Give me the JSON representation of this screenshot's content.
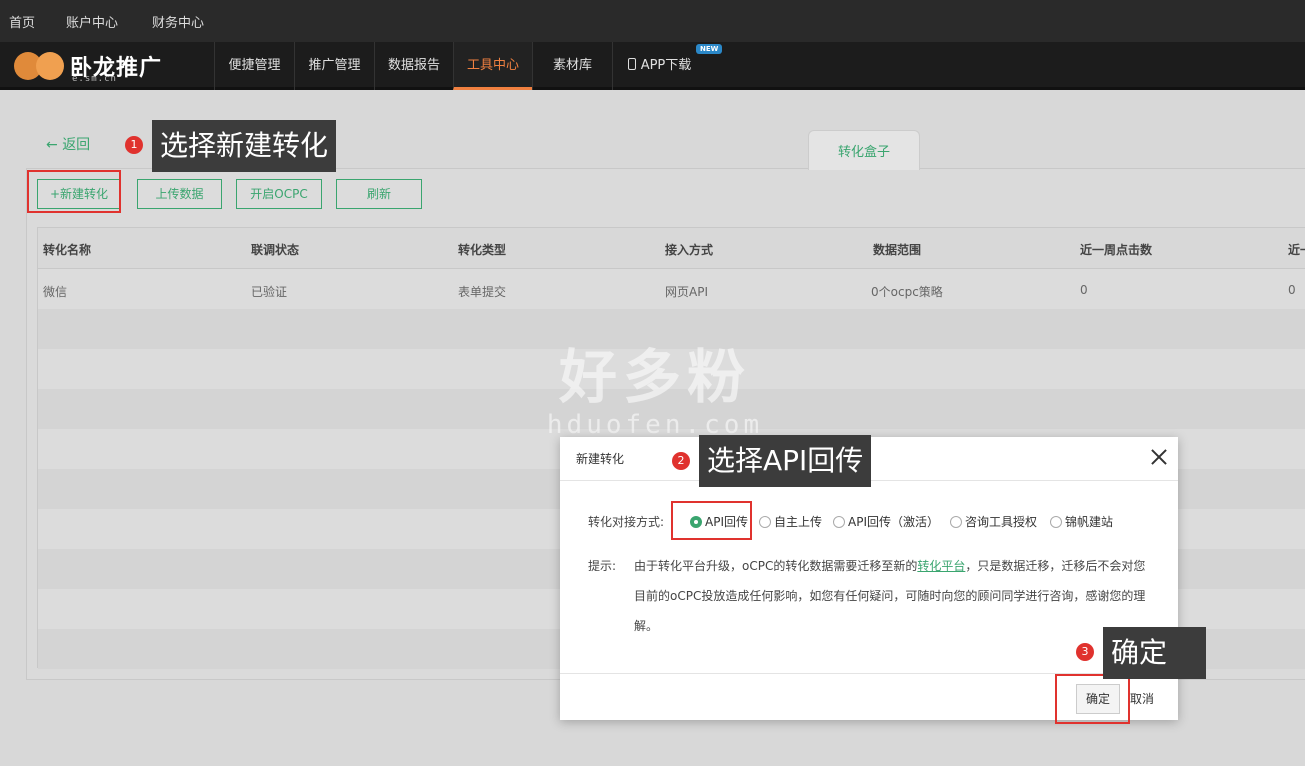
{
  "topbar": {
    "items": [
      "首页",
      "账户中心",
      "财务中心"
    ]
  },
  "logo": {
    "text": "卧龙推广",
    "sub": "e.sm.cn"
  },
  "nav": {
    "items": [
      "便捷管理",
      "推广管理",
      "数据报告",
      "工具中心",
      "素材库",
      "APP下载"
    ],
    "active": "工具中心",
    "new_badge": "NEW"
  },
  "back_label": "返回",
  "annotations": {
    "step1": {
      "num": "1",
      "text": "选择新建转化"
    },
    "step2": {
      "num": "2",
      "text": "选择API回传"
    },
    "step3": {
      "num": "3",
      "text": "确定"
    }
  },
  "tab": {
    "label": "转化盒子"
  },
  "toolbar": {
    "new_label": "+新建转化",
    "upload_label": "上传数据",
    "ocpc_label": "开启OCPC",
    "refresh_label": "刷新"
  },
  "table": {
    "headers": [
      "转化名称",
      "联调状态",
      "转化类型",
      "接入方式",
      "数据范围",
      "近一周点击数",
      "近一"
    ],
    "rows": [
      [
        "微信",
        "已验证",
        "表单提交",
        "网页API",
        "0个ocpc策略",
        "0",
        "0"
      ]
    ]
  },
  "watermark": {
    "cn": "好多粉",
    "en": "hduofen.com"
  },
  "modal": {
    "title": "新建转化",
    "method_label": "转化对接方式:",
    "options": [
      "API回传",
      "自主上传",
      "API回传（激活）",
      "咨询工具授权",
      "锦帆建站"
    ],
    "selected": "API回传",
    "tip_label": "提示:",
    "tip_before": "由于转化平台升级，oCPC的转化数据需要迁移至新的",
    "tip_link": "转化平台",
    "tip_after": "，只是数据迁移，迁移后不会对您目前的oCPC投放造成任何影响，如您有任何疑问，可随时向您的顾问同学进行咨询，感谢您的理解。",
    "ok_label": "确定",
    "cancel_label": "取消"
  },
  "colors": {
    "accent_green": "#3aa56f",
    "nav_active": "#f08040",
    "annotation_red": "#e0322e"
  }
}
